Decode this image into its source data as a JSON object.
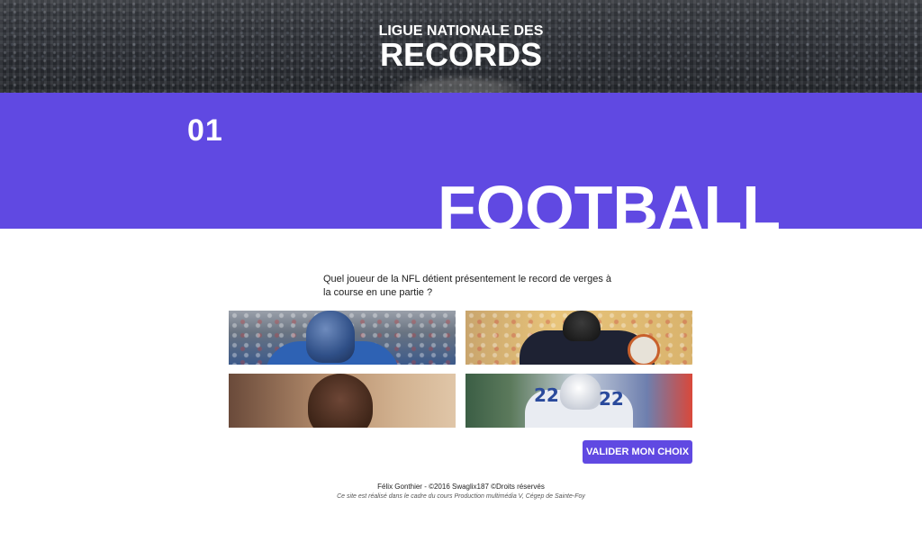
{
  "header": {
    "brand_line1": "LIGUE NATIONALE DES",
    "brand_line2": "RECORDS"
  },
  "section": {
    "number": "01",
    "title": "FOOTBALL",
    "accent_color": "#6049e2"
  },
  "question": {
    "text": "Quel joueur de la NFL détient présentement le record de verges à la course en une partie ?"
  },
  "choices": [
    {
      "id": "choice-1"
    },
    {
      "id": "choice-2"
    },
    {
      "id": "choice-3"
    },
    {
      "id": "choice-4"
    }
  ],
  "jersey_numbers": {
    "left": "22",
    "right": "22"
  },
  "submit": {
    "label": "VALIDER MON CHOIX"
  },
  "footer": {
    "credits": "Félix Gonthier - ©2016 Swaglix187 ©Droits réservés",
    "note": "Ce site est réalisé dans le cadre du cours Production multimédia V, Cégep de Sainte-Foy"
  }
}
